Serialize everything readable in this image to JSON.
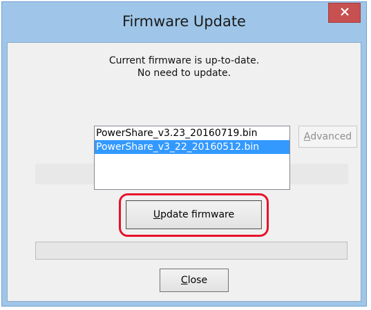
{
  "window": {
    "title": "Firmware Update"
  },
  "status": {
    "line1": "Current firmware is up-to-date.",
    "line2": "No need to update."
  },
  "firmware_list": {
    "items": [
      {
        "label": "PowerShare_v3.23_20160719.bin",
        "selected": false
      },
      {
        "label": "PowerShare_v3_22_20160512.bin",
        "selected": true
      }
    ]
  },
  "buttons": {
    "advanced": {
      "mnemonic": "A",
      "rest": "dvanced",
      "enabled": false
    },
    "update": {
      "mnemonic": "U",
      "rest": "pdate firmware"
    },
    "close": {
      "mnemonic": "C",
      "rest": "lose"
    }
  },
  "progress": {
    "value_percent": 0
  },
  "colors": {
    "selection": "#3399ff",
    "highlight_ring": "#e8102a",
    "close_button": "#c75050"
  },
  "icons": {
    "close": "close-icon"
  }
}
